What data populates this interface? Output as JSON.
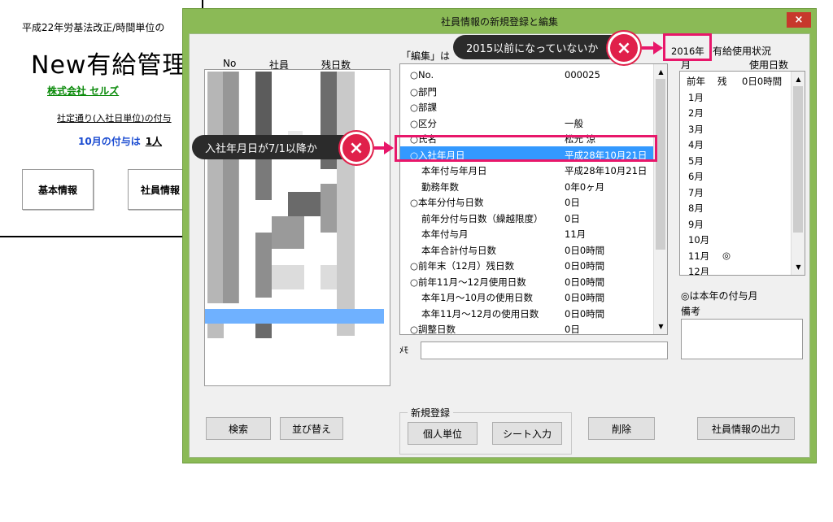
{
  "sheet": {
    "law_note": "平成22年労基法改正/時間単位の",
    "app_title": "New有給管理",
    "company": "株式会社 セルズ",
    "grant_rule": "社定通り(入社日単位)の付与",
    "grant_label": "10月の付与は",
    "grant_count": "1人",
    "btn_basic": "基本情報",
    "btn_employee": "社員情報"
  },
  "dialog": {
    "title": "社員情報の新規登録と編集",
    "close_glyph": "×",
    "list_headers": {
      "no": "No",
      "employee": "社員",
      "remaining": "残日数"
    },
    "edit_header": "「編集」は",
    "edit_rows": [
      {
        "label": "○No.",
        "value": "000025",
        "indent": false
      },
      {
        "label": "○部門",
        "value": "",
        "indent": false
      },
      {
        "label": "○部課",
        "value": "",
        "indent": false
      },
      {
        "label": "○区分",
        "value": "一般",
        "indent": false
      },
      {
        "label": "○氏名",
        "value": "松元 涼",
        "indent": false
      },
      {
        "label": "○入社年月日",
        "value": "平成28年10月21日",
        "indent": false,
        "selected": true
      },
      {
        "label": "本年付与年月日",
        "value": "平成28年10月21日",
        "indent": true
      },
      {
        "label": "勤務年数",
        "value": "0年0ヶ月",
        "indent": true
      },
      {
        "label": "○本年分付与日数",
        "value": "0日",
        "indent": false
      },
      {
        "label": "前年分付与日数（繰越限度）",
        "value": "0日",
        "indent": true
      },
      {
        "label": "本年付与月",
        "value": "11月",
        "indent": true
      },
      {
        "label": "本年合計付与日数",
        "value": "0日0時間",
        "indent": true
      },
      {
        "label": "○前年末（12月）残日数",
        "value": "0日0時間",
        "indent": false
      },
      {
        "label": "○前年11月～12月使用日数",
        "value": "0日0時間",
        "indent": false
      },
      {
        "label": "本年1月～10月の使用日数",
        "value": "0日0時間",
        "indent": true
      },
      {
        "label": "本年11月～12月の使用日数",
        "value": "0日0時間",
        "indent": true
      },
      {
        "label": "○調整日数",
        "value": "0日",
        "indent": false
      }
    ],
    "memo_label": "ﾒﾓ",
    "year_label": "2016年",
    "usage_title": "有給使用状況",
    "month_header": "月",
    "usage_header": "使用日数",
    "usage_rows": [
      {
        "month": "前年",
        "mark": "残",
        "value": "0日0時間"
      },
      {
        "month": "1月",
        "mark": "",
        "value": ""
      },
      {
        "month": "2月",
        "mark": "",
        "value": ""
      },
      {
        "month": "3月",
        "mark": "",
        "value": ""
      },
      {
        "month": "4月",
        "mark": "",
        "value": ""
      },
      {
        "month": "5月",
        "mark": "",
        "value": ""
      },
      {
        "month": "6月",
        "mark": "",
        "value": ""
      },
      {
        "month": "7月",
        "mark": "",
        "value": ""
      },
      {
        "month": "8月",
        "mark": "",
        "value": ""
      },
      {
        "month": "9月",
        "mark": "",
        "value": ""
      },
      {
        "month": "10月",
        "mark": "",
        "value": ""
      },
      {
        "month": "11月",
        "mark": "◎",
        "value": ""
      },
      {
        "month": "12月",
        "mark": "",
        "value": ""
      }
    ],
    "grant_month_note": "◎は本年の付与月",
    "remarks_label": "備考",
    "btn_search": "検索",
    "btn_sort": "並び替え",
    "new_group_label": "新規登録",
    "btn_individual": "個人単位",
    "btn_sheet_input": "シート入力",
    "btn_delete": "削除",
    "btn_export": "社員情報の出力"
  },
  "callouts": {
    "year_warning": "2015以前になっていないか",
    "hire_warning": "入社年月日が7/1以降か",
    "x_glyph": "×"
  },
  "colors": {
    "dialog_frame": "#8bba56",
    "selection": "#3399ff",
    "highlight": "#e8176a",
    "close_button": "#c7382c"
  }
}
